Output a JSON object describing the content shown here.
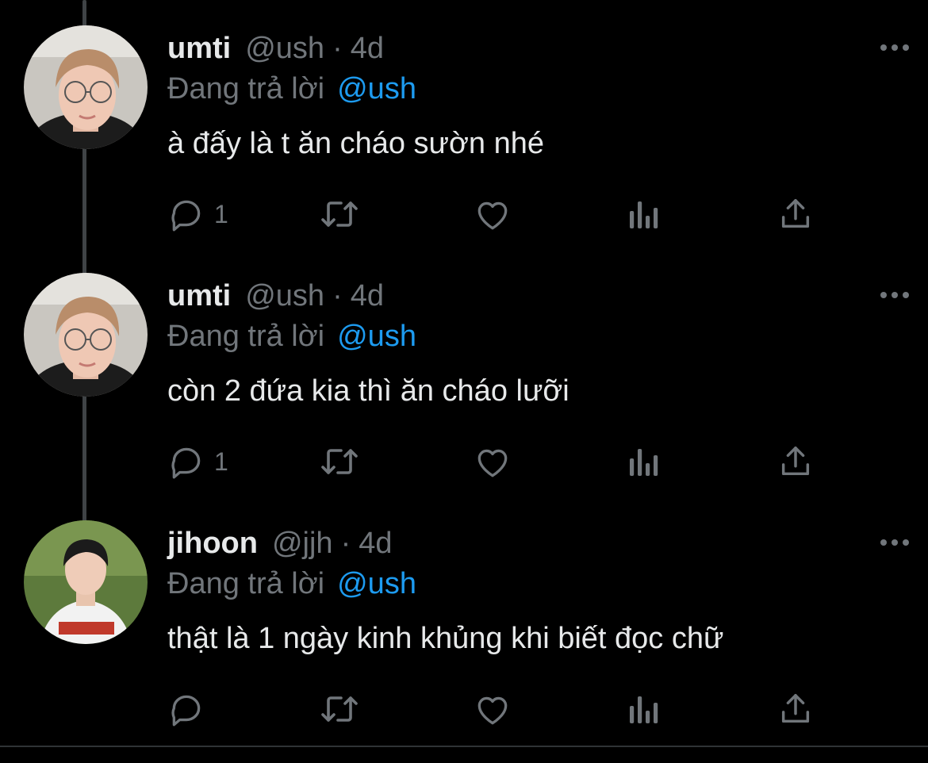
{
  "colors": {
    "background": "#000000",
    "text": "#e7e9ea",
    "muted": "#71767b",
    "accent": "#1d9bf0",
    "thread_line": "#3f4346"
  },
  "tweets": [
    {
      "name": "umti",
      "handle": "@ush",
      "separator": "·",
      "time": "4d",
      "reply_prefix": "Đang trả lời",
      "reply_to": "@ush",
      "text": "à đấy là t ăn cháo sườn nhé",
      "reply_count": "1",
      "avatar": "avatar-umti"
    },
    {
      "name": "umti",
      "handle": "@ush",
      "separator": "·",
      "time": "4d",
      "reply_prefix": "Đang trả lời",
      "reply_to": "@ush",
      "text": "còn 2 đứa kia thì ăn cháo lưỡi",
      "reply_count": "1",
      "avatar": "avatar-umti"
    },
    {
      "name": "jihoon",
      "handle": "@jjh",
      "separator": "·",
      "time": "4d",
      "reply_prefix": "Đang trả lời",
      "reply_to": "@ush",
      "text": "thật là 1 ngày kinh khủng khi biết đọc chữ",
      "reply_count": "",
      "avatar": "avatar-jihoon"
    }
  ],
  "icons": [
    "reply-icon",
    "retweet-icon",
    "like-icon",
    "views-icon",
    "share-icon",
    "more-icon"
  ]
}
